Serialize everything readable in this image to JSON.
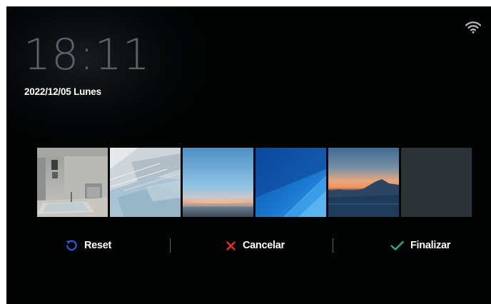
{
  "status_bar": {
    "wifi_icon": "wifi-icon"
  },
  "lock_screen": {
    "time": "18:11",
    "date": "2022/12/05 Lunes"
  },
  "wallpapers": [
    {
      "name": "interior-room"
    },
    {
      "name": "white-architecture"
    },
    {
      "name": "blue-sky-sunset"
    },
    {
      "name": "blue-abstract"
    },
    {
      "name": "orange-sunset-mountains"
    },
    {
      "name": "solid-dark-gray",
      "selected": true
    }
  ],
  "actions": {
    "reset_label": "Reset",
    "cancel_label": "Cancelar",
    "finish_label": "Finalizar"
  },
  "colors": {
    "reset_icon": "#2f5bd8",
    "cancel_icon": "#e3342f",
    "finish_icon": "#22b573",
    "selected_check": "#22b573"
  }
}
